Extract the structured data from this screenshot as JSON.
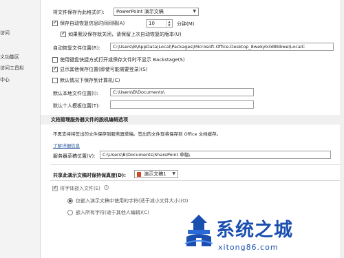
{
  "sidebar": {
    "items": [
      {
        "label": "访问"
      },
      {
        "label": "义功能区"
      },
      {
        "label": "访问工具栏"
      },
      {
        "label": "中心"
      }
    ]
  },
  "save": {
    "format_label": "将文件保存为此格式(F):",
    "format_value": "PowerPoint 演示文稿",
    "autorecover_label": "保存自动恢复信息时间间隔(A)",
    "autorecover_minutes": "10",
    "minutes_label": "分钟(M)",
    "keep_last_label": "如果我没保存就关闭，请保留上次自动恢复的版本(U)",
    "autorecover_location_label": "自动恢复文件位置(R):",
    "autorecover_location_value": "C:\\Users\\B\\AppData\\Local\\Packages\\Microsoft.Office.Desktop_8wekyb3d8bbwe\\LocalC",
    "no_backstage_label": "使用键盘快捷方式打开或保存文件时不显示 Backstage(S)",
    "show_more_locations_label": "显示其他保存位置(即使可能需要登录)(S)",
    "default_computer_label": "默认情况下保存到计算机(C)",
    "default_local_label": "默认本地文件位置(I):",
    "default_local_value": "C:\\Users\\B\\Documents\\",
    "default_template_label": "默认个人模板位置(T):",
    "default_template_value": ""
  },
  "offline": {
    "header": "文档管理服务器文件的脱机编辑选项",
    "description": "不再支持将签出的文件保存到服务器草稿。签出的文件现将保存到 Office 文档缓存。",
    "link": "了解详细信息",
    "drafts_label": "服务器草稿位置(V):",
    "drafts_value": "C:\\Users\\B\\Documents\\SharePoint 草稿\\"
  },
  "fidelity": {
    "header": "共享此演示文稿时保持保真度(D):",
    "presentation": "演示文稿1",
    "embed_fonts_label": "将字体嵌入文件(E)",
    "embed_used_label": "仅嵌入演示文稿中使用的字符(适于减小文件大小)(O)",
    "embed_all_label": "嵌入所有字符(适于其他人编辑)(C)"
  },
  "watermark": {
    "name": "系统之城",
    "url": "xitong86.com"
  },
  "colors": {
    "accent": "#2b579a",
    "watermark": "#1a4fb0"
  }
}
